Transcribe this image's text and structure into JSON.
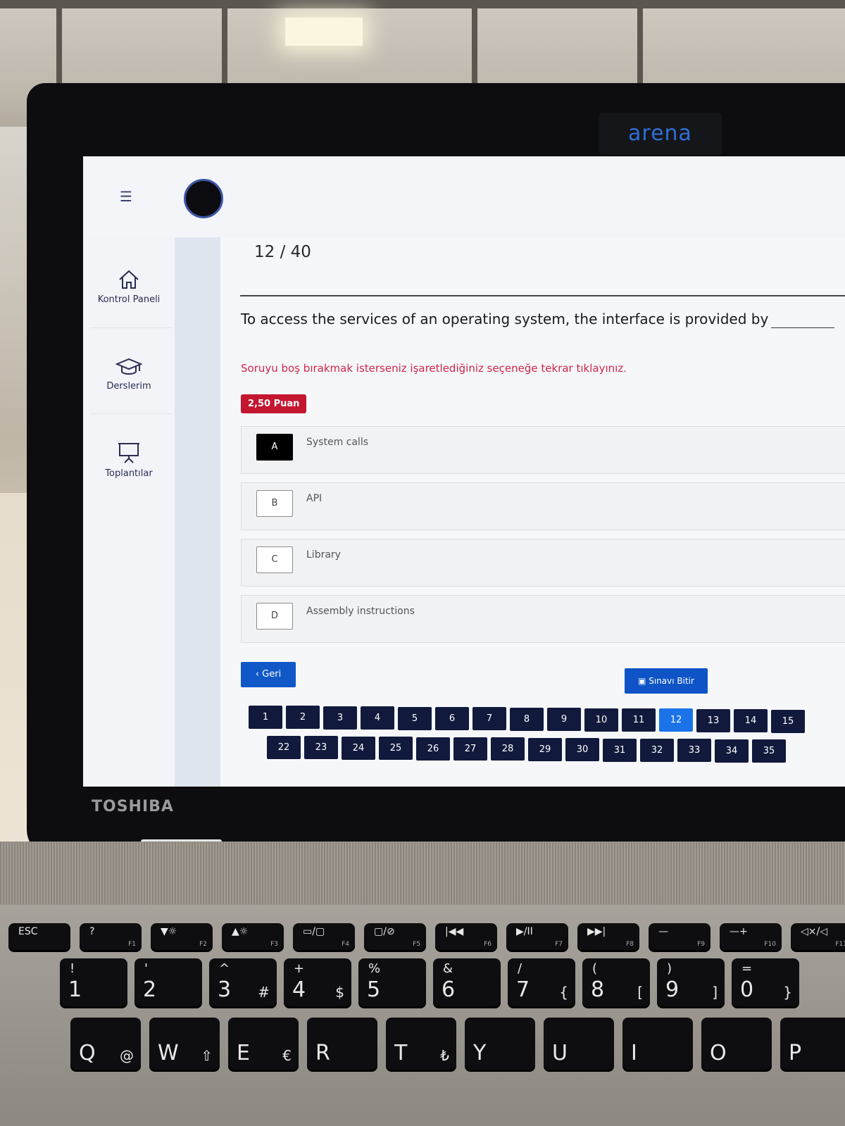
{
  "environment": {
    "camera_brand": "arena",
    "laptop_brand": "TOSHIBA"
  },
  "sidebar": {
    "items": [
      {
        "label": "Kontrol Paneli",
        "icon": "home-icon"
      },
      {
        "label": "Derslerim",
        "icon": "graduation-cap-icon"
      },
      {
        "label": "Toplantılar",
        "icon": "presentation-board-icon"
      }
    ]
  },
  "exam": {
    "counter": "12 / 40",
    "question": "To access the services of an operating system, the interface is provided by",
    "hint": "Soruyu boş bırakmak isterseniz işaretlediğiniz seçeneğe tekrar tıklayınız.",
    "points": "2,50 Puan",
    "options": [
      {
        "letter": "A",
        "text": "System calls",
        "selected": true
      },
      {
        "letter": "B",
        "text": "API",
        "selected": false
      },
      {
        "letter": "C",
        "text": "Library",
        "selected": false
      },
      {
        "letter": "D",
        "text": "Assembly instructions",
        "selected": false
      }
    ],
    "back_label": "Geri",
    "finish_label": "Sınavı Bitir",
    "current_question": 12,
    "nav_row1": [
      "1",
      "2",
      "3",
      "4",
      "5",
      "6",
      "7",
      "8",
      "9",
      "10",
      "11",
      "12",
      "13",
      "14",
      "15"
    ],
    "nav_row2": [
      "22",
      "23",
      "24",
      "25",
      "26",
      "27",
      "28",
      "29",
      "30",
      "31",
      "32",
      "33",
      "34",
      "35"
    ]
  },
  "colors": {
    "accent_blue": "#1058c8",
    "points_red": "#c4162f",
    "hint_red": "#d0264a",
    "nav_dark": "#111a3c",
    "nav_current": "#1a73e8"
  },
  "keyboard": {
    "fn_row": [
      {
        "label": "ESC",
        "fn": ""
      },
      {
        "label": "?",
        "fn": "F1"
      },
      {
        "label": "▼☼",
        "fn": "F2"
      },
      {
        "label": "▲☼",
        "fn": "F3"
      },
      {
        "label": "▭/▢",
        "fn": "F4"
      },
      {
        "label": "▢/⊘",
        "fn": "F5"
      },
      {
        "label": "|◀◀",
        "fn": "F6"
      },
      {
        "label": "▶/II",
        "fn": "F7"
      },
      {
        "label": "▶▶|",
        "fn": "F8"
      },
      {
        "label": "—",
        "fn": "F9"
      },
      {
        "label": "—+",
        "fn": "F10"
      },
      {
        "label": "◁×/◁",
        "fn": "F11"
      }
    ],
    "num_row": [
      {
        "main": "1",
        "top": "!",
        "sub": ""
      },
      {
        "main": "2",
        "top": "'",
        "sub": ""
      },
      {
        "main": "3",
        "top": "^",
        "sub": "#"
      },
      {
        "main": "4",
        "top": "+",
        "sub": "$"
      },
      {
        "main": "5",
        "top": "%",
        "sub": ""
      },
      {
        "main": "6",
        "top": "&",
        "sub": ""
      },
      {
        "main": "7",
        "top": "/",
        "sub": "{"
      },
      {
        "main": "8",
        "top": "(",
        "sub": "["
      },
      {
        "main": "9",
        "top": ")",
        "sub": "]"
      },
      {
        "main": "0",
        "top": "=",
        "sub": "}"
      }
    ],
    "letter_row": [
      {
        "main": "Q",
        "sub": "@"
      },
      {
        "main": "W",
        "sub": "⇧"
      },
      {
        "main": "E",
        "sub": "€"
      },
      {
        "main": "R",
        "sub": ""
      },
      {
        "main": "T",
        "sub": "₺"
      },
      {
        "main": "Y",
        "sub": ""
      },
      {
        "main": "U",
        "sub": ""
      },
      {
        "main": "I",
        "sub": ""
      },
      {
        "main": "O",
        "sub": ""
      },
      {
        "main": "P",
        "sub": ""
      }
    ]
  }
}
